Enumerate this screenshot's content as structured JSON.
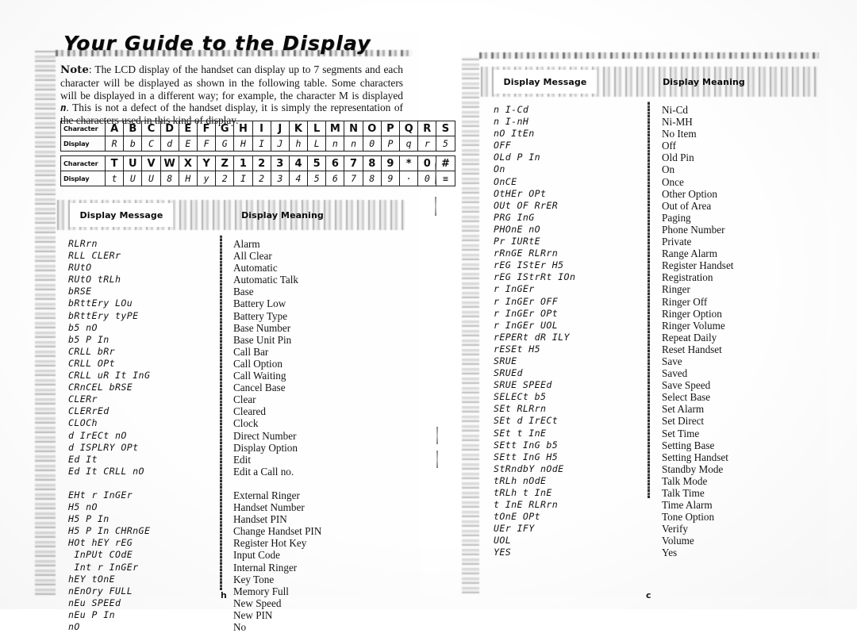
{
  "title": "Your Guide to the Display",
  "note": {
    "label": "Note",
    "text_part1": ": The LCD display of the handset can display up to 7 segments and each character will be displayed as shown in the following table. Some characters will be displayed in a different way; for example, the character M is displayed ",
    "lcd_example": "n",
    "text_part2": ". This is not a defect of the handset display, it is simply the representation of the characters used in this kind of display."
  },
  "char_tables": [
    {
      "row_labels": [
        "Character",
        "Display"
      ],
      "characters": [
        "A",
        "B",
        "C",
        "D",
        "E",
        "F",
        "G",
        "H",
        "I",
        "J",
        "K",
        "L",
        "M",
        "N",
        "O",
        "P",
        "Q",
        "R",
        "S"
      ],
      "displays": [
        "R",
        "b",
        "C",
        "d",
        "E",
        "F",
        "G",
        "H",
        "I",
        "J",
        "h",
        "L",
        "n",
        "n",
        "0",
        "P",
        "q",
        "r",
        "5"
      ]
    },
    {
      "row_labels": [
        "Character",
        "Display"
      ],
      "characters": [
        "T",
        "U",
        "V",
        "W",
        "X",
        "Y",
        "Z",
        "1",
        "2",
        "3",
        "4",
        "5",
        "6",
        "7",
        "8",
        "9",
        "*",
        "0",
        "#"
      ],
      "displays": [
        "t",
        "U",
        "U",
        "8",
        "H",
        "y",
        "2",
        "I",
        "2",
        "3",
        "4",
        "5",
        "6",
        "7",
        "8",
        "9",
        "·",
        "0",
        "≡"
      ]
    }
  ],
  "columns": {
    "message_header": "Display Message",
    "meaning_header": "Display Meaning"
  },
  "left_page": {
    "page_letter": "h",
    "entries": [
      {
        "message": "RLRrn",
        "meaning": "Alarm"
      },
      {
        "message": "RLL CLERr",
        "meaning": "All Clear"
      },
      {
        "message": "RUtO",
        "meaning": "Automatic"
      },
      {
        "message": "RUtO tRLh",
        "meaning": "Automatic Talk"
      },
      {
        "message": "bRSE",
        "meaning": "Base"
      },
      {
        "message": "bRttEry LOu",
        "meaning": "Battery Low"
      },
      {
        "message": "bRttEry tyPE",
        "meaning": "Battery Type"
      },
      {
        "message": "b5 nO",
        "meaning": "Base Number"
      },
      {
        "message": "b5 P In",
        "meaning": "Base Unit Pin"
      },
      {
        "message": "CRLL bRr",
        "meaning": "Call Bar"
      },
      {
        "message": "CRLL OPt",
        "meaning": "Call Option"
      },
      {
        "message": "CRLL uR It InG",
        "meaning": "Call Waiting"
      },
      {
        "message": "CRnCEL bRSE",
        "meaning": "Cancel Base"
      },
      {
        "message": "CLERr",
        "meaning": "Clear"
      },
      {
        "message": "CLERrEd",
        "meaning": "Cleared"
      },
      {
        "message": "CLOCh",
        "meaning": "Clock"
      },
      {
        "message": "d IrECt nO",
        "meaning": "Direct Number"
      },
      {
        "message": "d ISPLRY OPt",
        "meaning": "Display Option"
      },
      {
        "message": "Ed It",
        "meaning": "Edit"
      },
      {
        "message": "Ed It CRLL nO",
        "meaning": "Edit a Call no."
      },
      {
        "message": "",
        "meaning": ""
      },
      {
        "message": "EHt r InGEr",
        "meaning": "External Ringer"
      },
      {
        "message": "H5 nO",
        "meaning": "Handset Number"
      },
      {
        "message": "H5 P In",
        "meaning": "Handset PIN"
      },
      {
        "message": "H5 P In CHRnGE",
        "meaning": "Change Handset PIN"
      },
      {
        "message": "HOt hEY rEG",
        "meaning": "Register Hot Key"
      },
      {
        "message": " InPUt COdE",
        "meaning": "Input Code"
      },
      {
        "message": " Int r InGEr",
        "meaning": "Internal Ringer"
      },
      {
        "message": "hEY tOnE",
        "meaning": "Key Tone"
      },
      {
        "message": "nEnOry FULL",
        "meaning": "Memory Full"
      },
      {
        "message": "nEu SPEEd",
        "meaning": "New Speed"
      },
      {
        "message": "nEu P In",
        "meaning": "New PIN"
      },
      {
        "message": "nO",
        "meaning": "No"
      }
    ]
  },
  "right_page": {
    "page_letter": "c",
    "entries": [
      {
        "message": "n I-Cd",
        "meaning": "Ni-Cd"
      },
      {
        "message": "n I-nH",
        "meaning": "Ni-MH"
      },
      {
        "message": "nO ItEn",
        "meaning": "No Item"
      },
      {
        "message": "OFF",
        "meaning": "Off"
      },
      {
        "message": "OLd P In",
        "meaning": "Old Pin"
      },
      {
        "message": "On",
        "meaning": "On"
      },
      {
        "message": "OnCE",
        "meaning": "Once"
      },
      {
        "message": "OtHEr OPt",
        "meaning": "Other Option"
      },
      {
        "message": "OUt OF RrER",
        "meaning": "Out of Area"
      },
      {
        "message": "PRG InG",
        "meaning": "Paging"
      },
      {
        "message": "PHOnE nO",
        "meaning": "Phone Number"
      },
      {
        "message": "Pr IURtE",
        "meaning": "Private"
      },
      {
        "message": "rRnGE RLRrn",
        "meaning": "Range Alarm"
      },
      {
        "message": "rEG IStEr H5",
        "meaning": "Register Handset"
      },
      {
        "message": "rEG IStrRt IOn",
        "meaning": "Registration"
      },
      {
        "message": "r InGEr",
        "meaning": "Ringer"
      },
      {
        "message": "r InGEr OFF",
        "meaning": "Ringer Off"
      },
      {
        "message": "r InGEr OPt",
        "meaning": "Ringer Option"
      },
      {
        "message": "r InGEr UOL",
        "meaning": "Ringer Volume"
      },
      {
        "message": "rEPERt dR ILY",
        "meaning": "Repeat Daily"
      },
      {
        "message": "rESEt H5",
        "meaning": "Reset Handset"
      },
      {
        "message": "SRUE",
        "meaning": "Save"
      },
      {
        "message": "SRUEd",
        "meaning": "Saved"
      },
      {
        "message": "SRUE SPEEd",
        "meaning": "Save Speed"
      },
      {
        "message": "SELECt b5",
        "meaning": "Select Base"
      },
      {
        "message": "SEt RLRrn",
        "meaning": "Set Alarm"
      },
      {
        "message": "SEt d IrECt",
        "meaning": "Set Direct"
      },
      {
        "message": "SEt t InE",
        "meaning": "Set Time"
      },
      {
        "message": "SEtt InG b5",
        "meaning": "Setting Base"
      },
      {
        "message": "SEtt InG H5",
        "meaning": "Setting Handset"
      },
      {
        "message": "StRndbY nOdE",
        "meaning": "Standby Mode"
      },
      {
        "message": "tRLh nOdE",
        "meaning": "Talk Mode"
      },
      {
        "message": "tRLh t InE",
        "meaning": "Talk Time"
      },
      {
        "message": "t InE RLRrn",
        "meaning": "Time Alarm"
      },
      {
        "message": "tOnE OPt",
        "meaning": "Tone Option"
      },
      {
        "message": "UEr IFY",
        "meaning": "Verify"
      },
      {
        "message": "UOL",
        "meaning": "Volume"
      },
      {
        "message": "YES",
        "meaning": "Yes"
      }
    ]
  }
}
